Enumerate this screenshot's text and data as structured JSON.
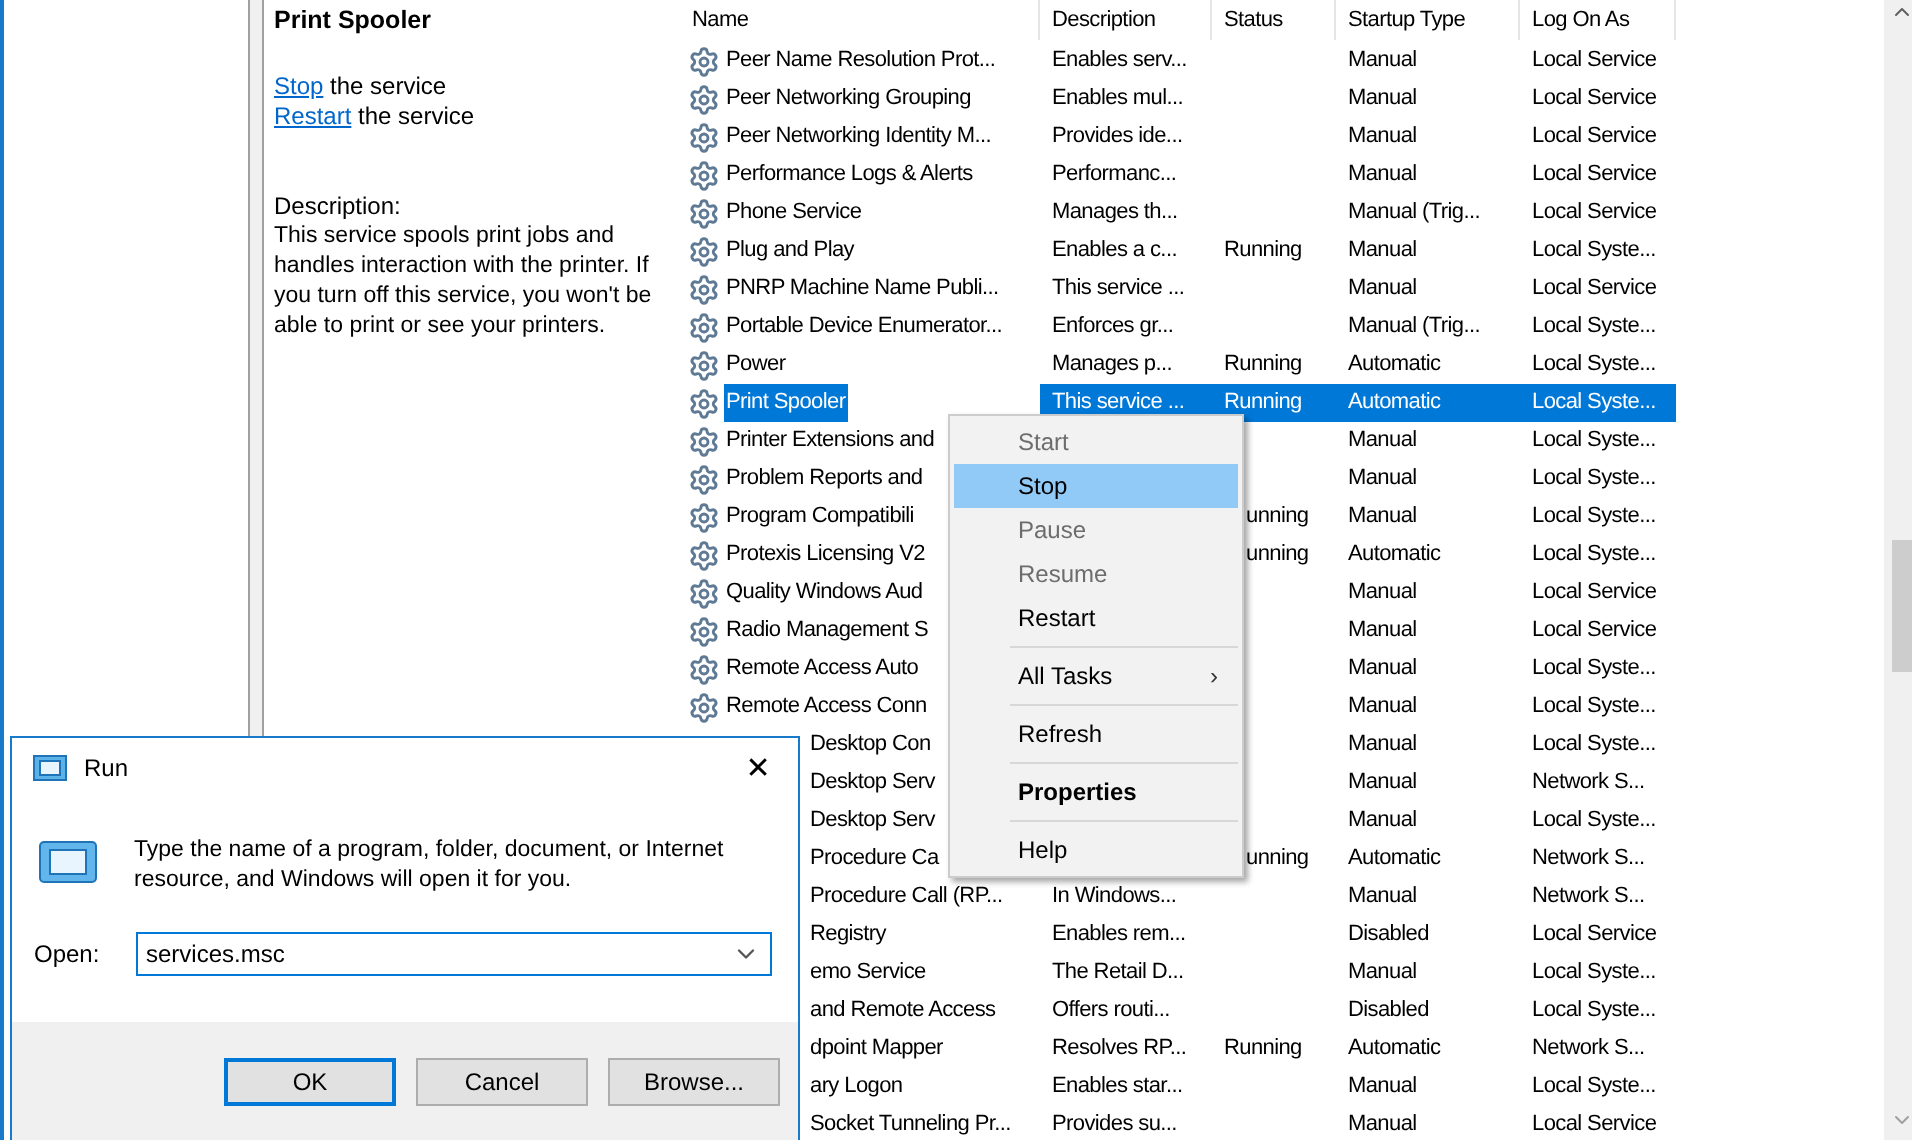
{
  "details": {
    "title": "Print Spooler",
    "actions": [
      {
        "link": "Stop",
        "text": "the service"
      },
      {
        "link": "Restart",
        "text": "the service"
      }
    ],
    "description_label": "Description:",
    "description": "This service spools print jobs and handles interaction with the printer. If you turn off this service, you won't be able to print or see your printers."
  },
  "table": {
    "columns": [
      "Name",
      "Description",
      "Status",
      "Startup Type",
      "Log On As"
    ],
    "rows": [
      {
        "name": "Peer Name Resolution Prot...",
        "description": "Enables serv...",
        "startup": "Manual",
        "logon": "Local Service",
        "selected": false
      },
      {
        "name": "Peer Networking Grouping",
        "description": "Enables mul...",
        "startup": "Manual",
        "logon": "Local Service",
        "selected": false
      },
      {
        "name": "Peer Networking Identity M...",
        "description": "Provides ide...",
        "startup": "Manual",
        "logon": "Local Service",
        "selected": false
      },
      {
        "name": "Performance Logs & Alerts",
        "description": "Performanc...",
        "startup": "Manual",
        "logon": "Local Service",
        "selected": false
      },
      {
        "name": "Phone Service",
        "description": "Manages th...",
        "startup": "Manual (Trig...",
        "logon": "Local Service",
        "selected": false
      },
      {
        "name": "Plug and Play",
        "description": "Enables a c...",
        "status": "Running",
        "startup": "Manual",
        "logon": "Local Syste...",
        "selected": false
      },
      {
        "name": "PNRP Machine Name Publi...",
        "description": "This service ...",
        "startup": "Manual",
        "logon": "Local Service",
        "selected": false
      },
      {
        "name": "Portable Device Enumerator...",
        "description": "Enforces gr...",
        "startup": "Manual (Trig...",
        "logon": "Local Syste...",
        "selected": false
      },
      {
        "name": "Power",
        "description": "Manages p...",
        "status": "Running",
        "startup": "Automatic",
        "logon": "Local Syste...",
        "selected": false
      },
      {
        "name": "Print Spooler",
        "description": "This service ...",
        "status": "Running",
        "startup": "Automatic",
        "logon": "Local Syste...",
        "selected": true
      },
      {
        "name": "Printer Extensions and",
        "startup": "Manual",
        "logon": "Local Syste...",
        "selected": false
      },
      {
        "name": "Problem Reports and",
        "startup": "Manual",
        "logon": "Local Syste...",
        "selected": false
      },
      {
        "name": "Program Compatibili",
        "status": "unning",
        "status_cut": true,
        "startup": "Manual",
        "logon": "Local Syste...",
        "selected": false
      },
      {
        "name": "Protexis Licensing V2",
        "status": "unning",
        "status_cut": true,
        "startup": "Automatic",
        "logon": "Local Syste...",
        "selected": false
      },
      {
        "name": "Quality Windows Aud",
        "startup": "Manual",
        "logon": "Local Service",
        "selected": false
      },
      {
        "name": "Radio Management S",
        "startup": "Manual",
        "logon": "Local Service",
        "selected": false
      },
      {
        "name": "Remote Access Auto",
        "startup": "Manual",
        "logon": "Local Syste...",
        "selected": false
      },
      {
        "name": "Remote Access Conn",
        "startup": "Manual",
        "logon": "Local Syste...",
        "selected": false
      },
      {
        "name": "Desktop Con",
        "start_covered": true,
        "startup": "Manual",
        "logon": "Local Syste...",
        "selected": false
      },
      {
        "name": "Desktop Serv",
        "start_covered": true,
        "startup": "Manual",
        "logon": "Network S...",
        "selected": false
      },
      {
        "name": "Desktop Serv",
        "start_covered": true,
        "startup": "Manual",
        "logon": "Local Syste...",
        "selected": false
      },
      {
        "name": "Procedure Ca",
        "start_covered": true,
        "status": "unning",
        "status_cut": true,
        "startup": "Automatic",
        "logon": "Network S...",
        "selected": false
      },
      {
        "name": "Procedure Call (RP...",
        "start_covered": true,
        "description": "In Windows...",
        "startup": "Manual",
        "logon": "Network S...",
        "selected": false
      },
      {
        "name": "Registry",
        "start_covered": true,
        "description": "Enables rem...",
        "startup": "Disabled",
        "logon": "Local Service",
        "selected": false
      },
      {
        "name": "emo Service",
        "start_covered": true,
        "description": "The Retail D...",
        "startup": "Manual",
        "logon": "Local Syste...",
        "selected": false
      },
      {
        "name": "and Remote Access",
        "start_covered": true,
        "description": "Offers routi...",
        "startup": "Disabled",
        "logon": "Local Syste...",
        "selected": false
      },
      {
        "name": "dpoint Mapper",
        "start_covered": true,
        "description": "Resolves RP...",
        "status": "Running",
        "startup": "Automatic",
        "logon": "Network S...",
        "selected": false
      },
      {
        "name": "ary Logon",
        "start_covered": true,
        "description": "Enables star...",
        "startup": "Manual",
        "logon": "Local Syste...",
        "selected": false
      },
      {
        "name": "Socket Tunneling Pr...",
        "start_covered": true,
        "description": "Provides su...",
        "startup": "Manual",
        "logon": "Local Service",
        "selected": false
      }
    ]
  },
  "context_menu": [
    {
      "kind": "item",
      "label": "Start",
      "disabled": true,
      "selected": false
    },
    {
      "kind": "item",
      "label": "Stop",
      "disabled": false,
      "selected": true
    },
    {
      "kind": "item",
      "label": "Pause",
      "disabled": true,
      "selected": false
    },
    {
      "kind": "item",
      "label": "Resume",
      "disabled": true,
      "selected": false
    },
    {
      "kind": "item",
      "label": "Restart",
      "disabled": false,
      "selected": false
    },
    {
      "kind": "separator"
    },
    {
      "kind": "item",
      "label": "All Tasks",
      "disabled": false,
      "selected": false,
      "submenu": true,
      "arrow": "›"
    },
    {
      "kind": "separator"
    },
    {
      "kind": "item",
      "label": "Refresh",
      "disabled": false,
      "selected": false
    },
    {
      "kind": "separator"
    },
    {
      "kind": "item",
      "label": "Properties",
      "disabled": false,
      "selected": false,
      "default": true
    },
    {
      "kind": "separator"
    },
    {
      "kind": "item",
      "label": "Help",
      "disabled": false,
      "selected": false
    }
  ],
  "run_dialog": {
    "title": "Run",
    "close": "✕",
    "message": "Type the name of a program, folder, document, or Internet resource, and Windows will open it for you.",
    "open_label": "Open:",
    "value": "services.msc",
    "buttons": [
      {
        "label": "OK",
        "default": true
      },
      {
        "label": "Cancel",
        "default": false
      },
      {
        "label": "Browse...",
        "default": false
      }
    ]
  }
}
